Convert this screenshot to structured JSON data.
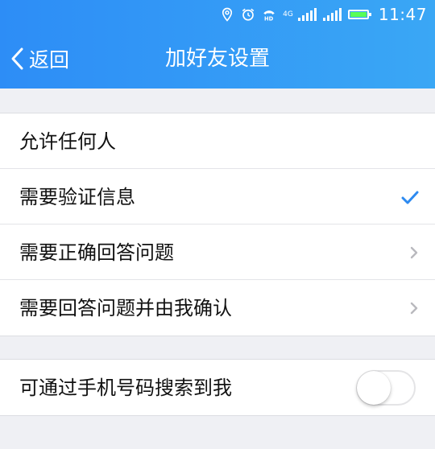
{
  "status": {
    "network": "4G",
    "time": "11:47",
    "icons": [
      "location-icon",
      "alarm-icon",
      "hd-call-icon",
      "signal-icon",
      "signal-icon",
      "battery-icon"
    ]
  },
  "nav": {
    "back_label": "返回",
    "title": "加好友设置"
  },
  "options": [
    {
      "label": "允许任何人",
      "accessory": "none"
    },
    {
      "label": "需要验证信息",
      "accessory": "check"
    },
    {
      "label": "需要正确回答问题",
      "accessory": "chevron"
    },
    {
      "label": "需要回答问题并由我确认",
      "accessory": "chevron"
    }
  ],
  "phone_search": {
    "label": "可通过手机号码搜索到我",
    "enabled": false
  },
  "colors": {
    "header_start": "#2d8df6",
    "header_end": "#3aa7f5",
    "accent": "#2d8af0",
    "background": "#eff0f4"
  }
}
